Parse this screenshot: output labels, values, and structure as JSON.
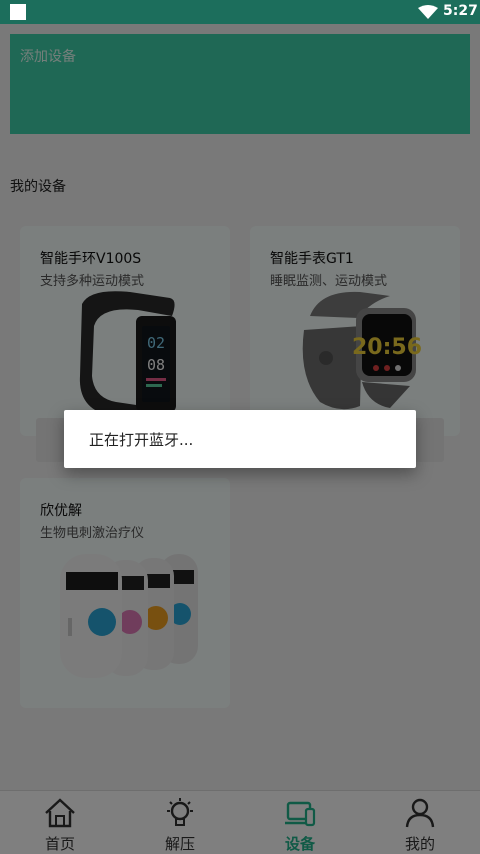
{
  "status_bar": {
    "time": "5:27",
    "wifi_icon": "wifi-icon",
    "notification_icon": "square-icon"
  },
  "add_device": {
    "label": "添加设备"
  },
  "section": {
    "title": "我的设备"
  },
  "devices": [
    {
      "name": "智能手环V100S",
      "desc": "支持多种运动模式",
      "image": "fitness-band-image"
    },
    {
      "name": "智能手表GT1",
      "desc": "睡眠监测、运动模式",
      "image": "smart-watch-image",
      "watch_time": "20:56"
    },
    {
      "name": "欣优解",
      "desc": "生物电刺激治疗仪",
      "image": "therapy-device-image"
    }
  ],
  "band_screen": {
    "line1": "02",
    "line2": "08"
  },
  "dialog": {
    "message": "正在打开蓝牙..."
  },
  "bottom_nav": [
    {
      "label": "首页",
      "icon": "home-icon"
    },
    {
      "label": "解压",
      "icon": "lightbulb-icon"
    },
    {
      "label": "设备",
      "icon": "device-icon",
      "active": true
    },
    {
      "label": "我的",
      "icon": "user-icon"
    }
  ],
  "colors": {
    "accent": "#21b48c",
    "status_bar": "#1c6e5c",
    "banner": "#3fd0aa"
  }
}
